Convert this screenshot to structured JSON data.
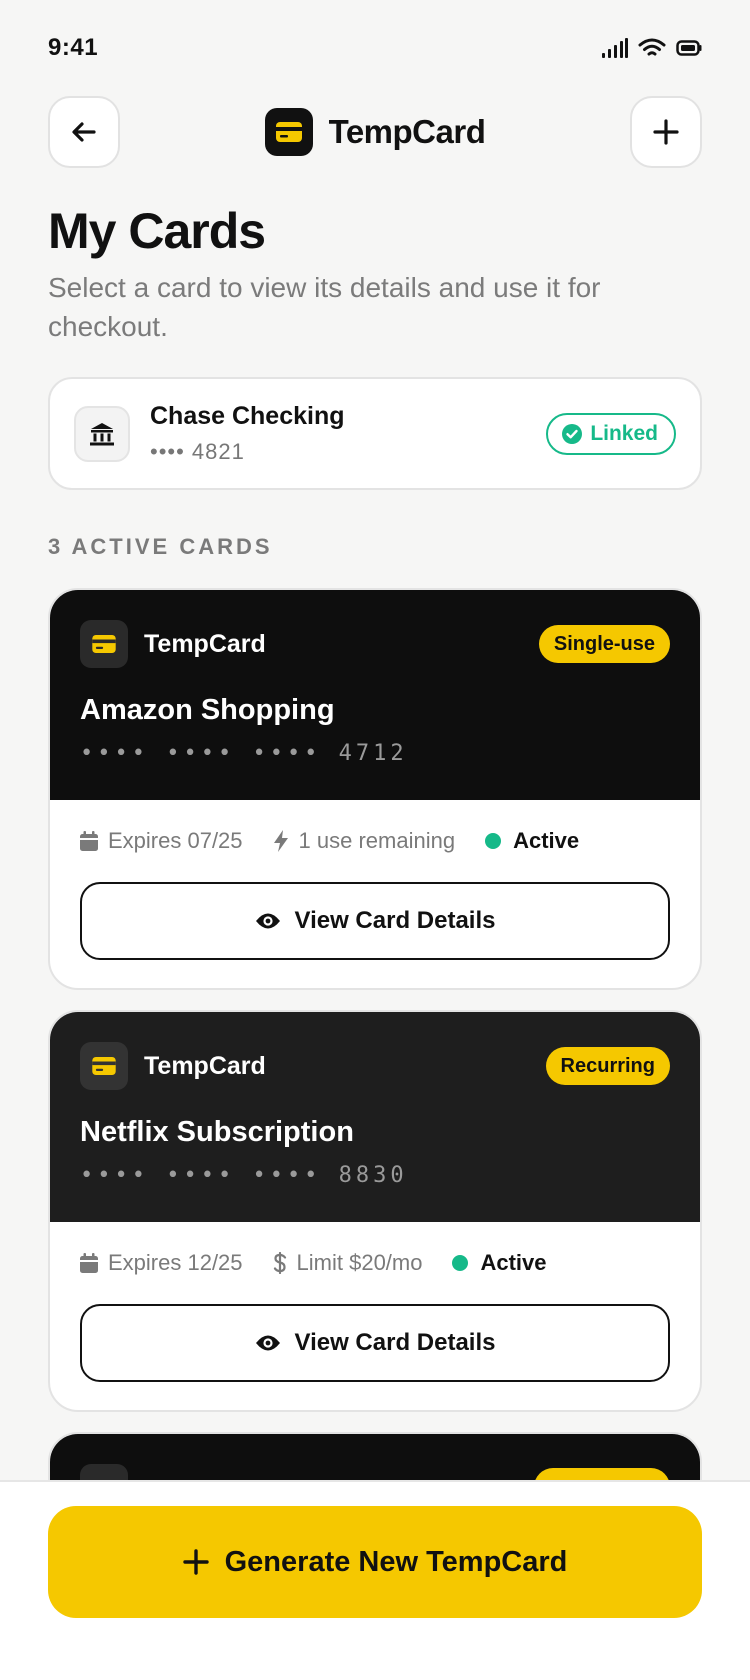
{
  "status_bar": {
    "time": "9:41",
    "icons": [
      "signal-icon",
      "wifi-icon",
      "battery-icon"
    ]
  },
  "header": {
    "back_icon": "arrow-left-icon",
    "brand_name": "TempCard",
    "add_icon": "plus-icon"
  },
  "page": {
    "title": "My Cards",
    "subtitle": "Select a card to view its details and use it for checkout."
  },
  "bank": {
    "icon": "bank-icon",
    "name": "Chase Checking",
    "masked_number": "•••• 4821",
    "status": "Linked"
  },
  "section_label": "3 ACTIVE CARDS",
  "cards": [
    {
      "brand": "TempCard",
      "badge": "Single-use",
      "name": "Amazon Shopping",
      "masked_number": "•••• •••• •••• 4712",
      "expires": "Expires 07/25",
      "usage": "1 use remaining",
      "usage_icon": "bolt-icon",
      "status": "Active",
      "button": "View Card Details",
      "bg": "#0e0e0e"
    },
    {
      "brand": "TempCard",
      "badge": "Recurring",
      "name": "Netflix Subscription",
      "masked_number": "•••• •••• •••• 8830",
      "expires": "Expires 12/25",
      "usage": "Limit $20/mo",
      "usage_icon": "dollar-icon",
      "status": "Active",
      "button": "View Card Details",
      "bg": "#1e1e1e"
    }
  ],
  "footer": {
    "button": "Generate New TempCard"
  },
  "colors": {
    "accent": "#f5c800",
    "success": "#16b989",
    "card_dark": "#0e0e0e"
  }
}
